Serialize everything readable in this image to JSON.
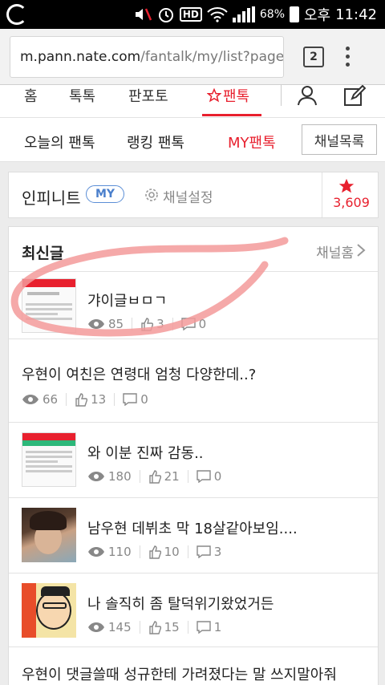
{
  "status_bar": {
    "battery": "68%",
    "ampm": "오후",
    "time": "11:42",
    "hd_label": "HD"
  },
  "browser": {
    "url_host": "m.pann.nate.com",
    "url_path": "/fantalk/my/list?page=",
    "tab_count": "2"
  },
  "top_nav": {
    "items": [
      {
        "label": "홈"
      },
      {
        "label": "톡톡"
      },
      {
        "label": "판포토"
      },
      {
        "label": "팬톡",
        "icon": "star-outline-icon"
      }
    ],
    "active_color": "#e8202e"
  },
  "sub_nav": {
    "items": [
      {
        "label": "오늘의 팬톡"
      },
      {
        "label": "랭킹 팬톡"
      },
      {
        "label": "MY팬톡"
      }
    ],
    "channel_list_button": "채널목록"
  },
  "channel": {
    "name": "인피니트",
    "badge": "MY",
    "settings_label": "채널설정",
    "star_count": "3,609"
  },
  "list": {
    "title": "최신글",
    "home_link": "채널홈",
    "posts": [
      {
        "title": "갸이글ㅂㅁㄱ",
        "views": "85",
        "likes": "3",
        "comments": "0",
        "thumb": "screenshot-thumb"
      },
      {
        "title": "우현이 여친은 연령대 엄청 다양한데..?",
        "views": "66",
        "likes": "13",
        "comments": "0",
        "thumb": ""
      },
      {
        "title": "와 이분 진짜 감동..",
        "views": "180",
        "likes": "21",
        "comments": "0",
        "thumb": "screenshot-thumb"
      },
      {
        "title": "남우현 데뷔초 막 18살같아보임....",
        "views": "110",
        "likes": "10",
        "comments": "3",
        "thumb": "photo-thumb"
      },
      {
        "title": "나 솔직히 좀 탈덕위기왔었거든",
        "views": "145",
        "likes": "15",
        "comments": "1",
        "thumb": "cartoon-thumb"
      },
      {
        "title": "우현이 댓글쓸때 성규한테 가려졌다는 말 쓰지말아줘",
        "views": "",
        "likes": "",
        "comments": "",
        "thumb": ""
      }
    ]
  },
  "colors": {
    "accent": "#e8202e",
    "badge_blue": "#4a7fcc",
    "annotation": "#f39a9a"
  }
}
